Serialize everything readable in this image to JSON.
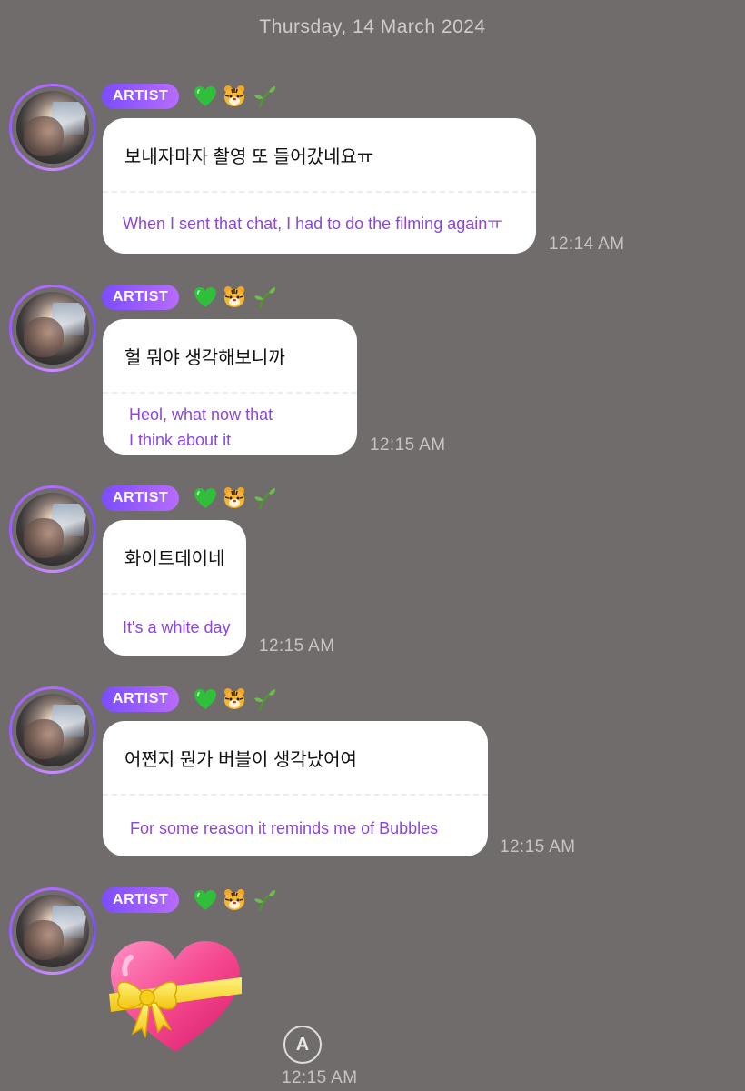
{
  "date_header": "Thursday, 14 March 2024",
  "sender": {
    "badge": "ARTIST",
    "emojis": [
      "green-heart",
      "tiger-face",
      "seedling"
    ]
  },
  "messages": [
    {
      "ko": "보내자마자 촬영 또 들어갔네요ㅠ",
      "en_lines": [
        "When I sent that chat, I had to do the filming againㅠ"
      ],
      "time": "12:14 AM"
    },
    {
      "ko": "헐 뭐야 생각해보니까",
      "en_lines": [
        "Heol, what now that",
        "I think about it"
      ],
      "time": "12:15 AM"
    },
    {
      "ko": "화이트데이네",
      "en_lines": [
        "It's a white day"
      ],
      "time": "12:15 AM"
    },
    {
      "ko": "어쩐지 뭔가 버블이 생각났어여",
      "en_lines": [
        "For some reason it reminds me of Bubbles"
      ],
      "time": "12:15 AM"
    },
    {
      "sticker": "heart-with-ribbon",
      "time": "12:15 AM",
      "translate_icon": "A"
    }
  ]
}
